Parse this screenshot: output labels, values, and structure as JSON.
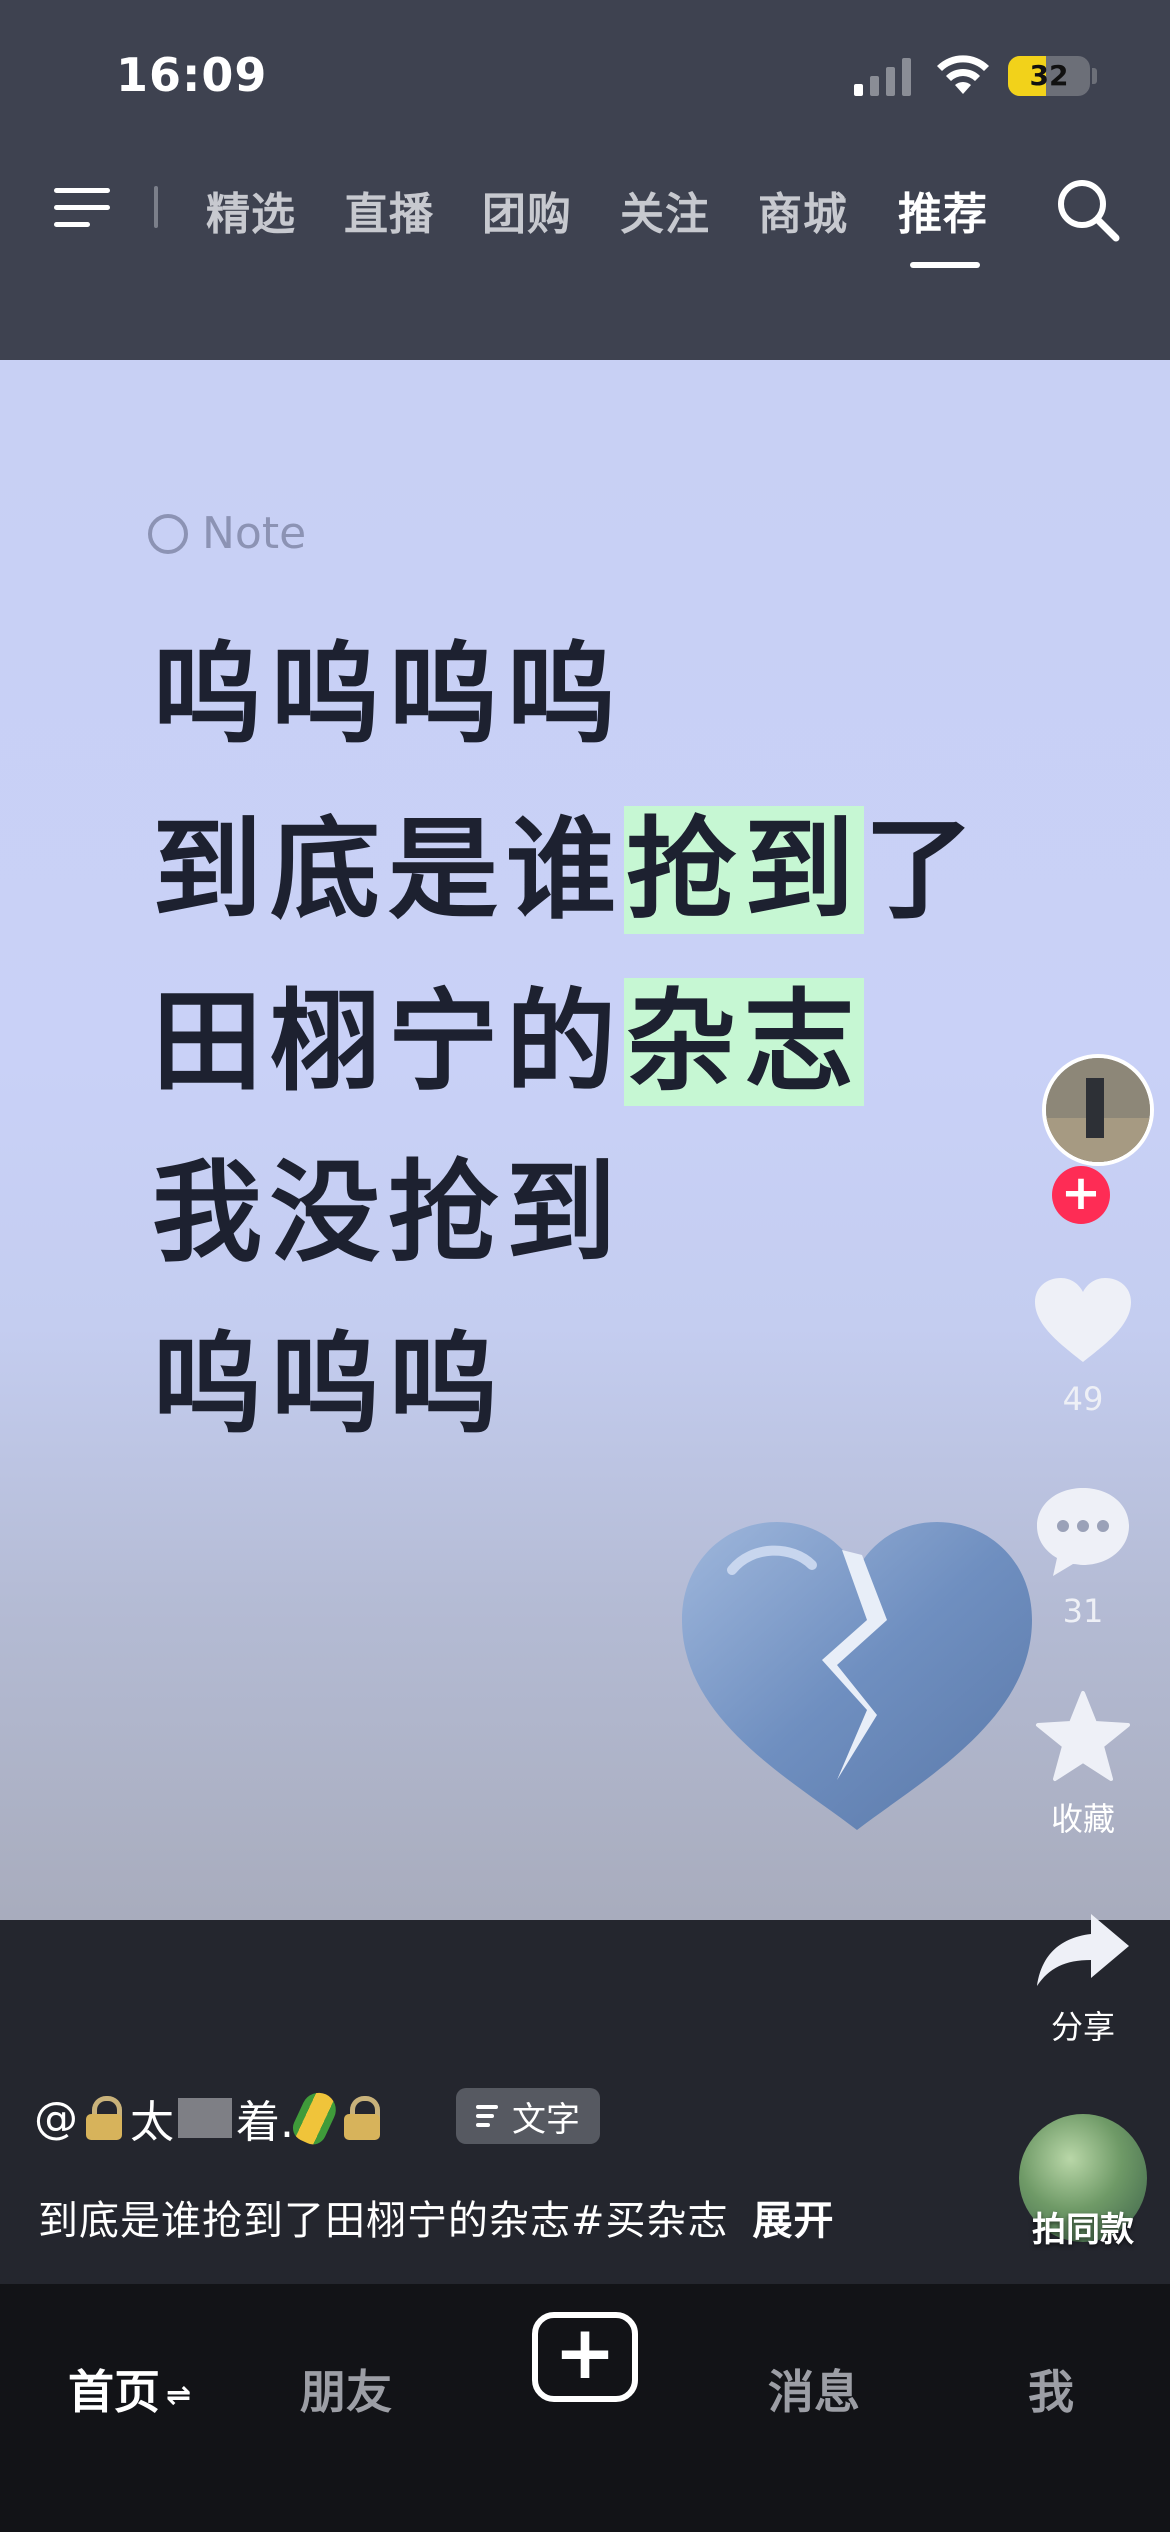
{
  "status_bar": {
    "time": "16:09",
    "battery": "32",
    "icons": [
      "cellular-signal-icon",
      "wifi-icon",
      "battery-icon"
    ]
  },
  "top_nav": {
    "menu_icon": "hamburger-menu-icon",
    "tabs": [
      {
        "label": "精选"
      },
      {
        "label": "直播"
      },
      {
        "label": "团购"
      },
      {
        "label": "关注"
      },
      {
        "label": "商城"
      },
      {
        "label": "推荐",
        "active": true
      }
    ],
    "search_icon": "search-icon"
  },
  "post": {
    "note_label": "Note",
    "lines": [
      {
        "parts": [
          {
            "text": "呜呜呜呜",
            "hl": false
          }
        ]
      },
      {
        "parts": [
          {
            "text": "到底是谁",
            "hl": false
          },
          {
            "text": "抢到",
            "hl": true
          },
          {
            "text": "了",
            "hl": false
          }
        ]
      },
      {
        "parts": [
          {
            "text": "田栩宁的",
            "hl": false
          },
          {
            "text": "杂志",
            "hl": true
          }
        ]
      },
      {
        "parts": [
          {
            "text": "我没抢到",
            "hl": false
          }
        ]
      },
      {
        "parts": [
          {
            "text": "呜呜呜",
            "hl": false
          }
        ]
      }
    ],
    "highlight_color": "#c6f7d3",
    "background_color": "#c8d0f4",
    "sticker": "broken-heart-icon"
  },
  "actions": {
    "follow_label": "+",
    "likes": "49",
    "comments": "31",
    "favorite_label": "收藏",
    "share_label": "分享",
    "accent_color": "#fe2c55"
  },
  "caption": {
    "author_prefix": "@",
    "author_name_part1": "太",
    "author_name_part2": "着.",
    "text_tag": "文字",
    "description": "到底是谁抢到了田栩宁的杂志#买杂志",
    "expand": "展开"
  },
  "same_style": {
    "label": "拍同款"
  },
  "bottom_tabs": {
    "home": "首页",
    "home_arrows": "⇌",
    "friends": "朋友",
    "create": "+",
    "messages": "消息",
    "me": "我"
  }
}
